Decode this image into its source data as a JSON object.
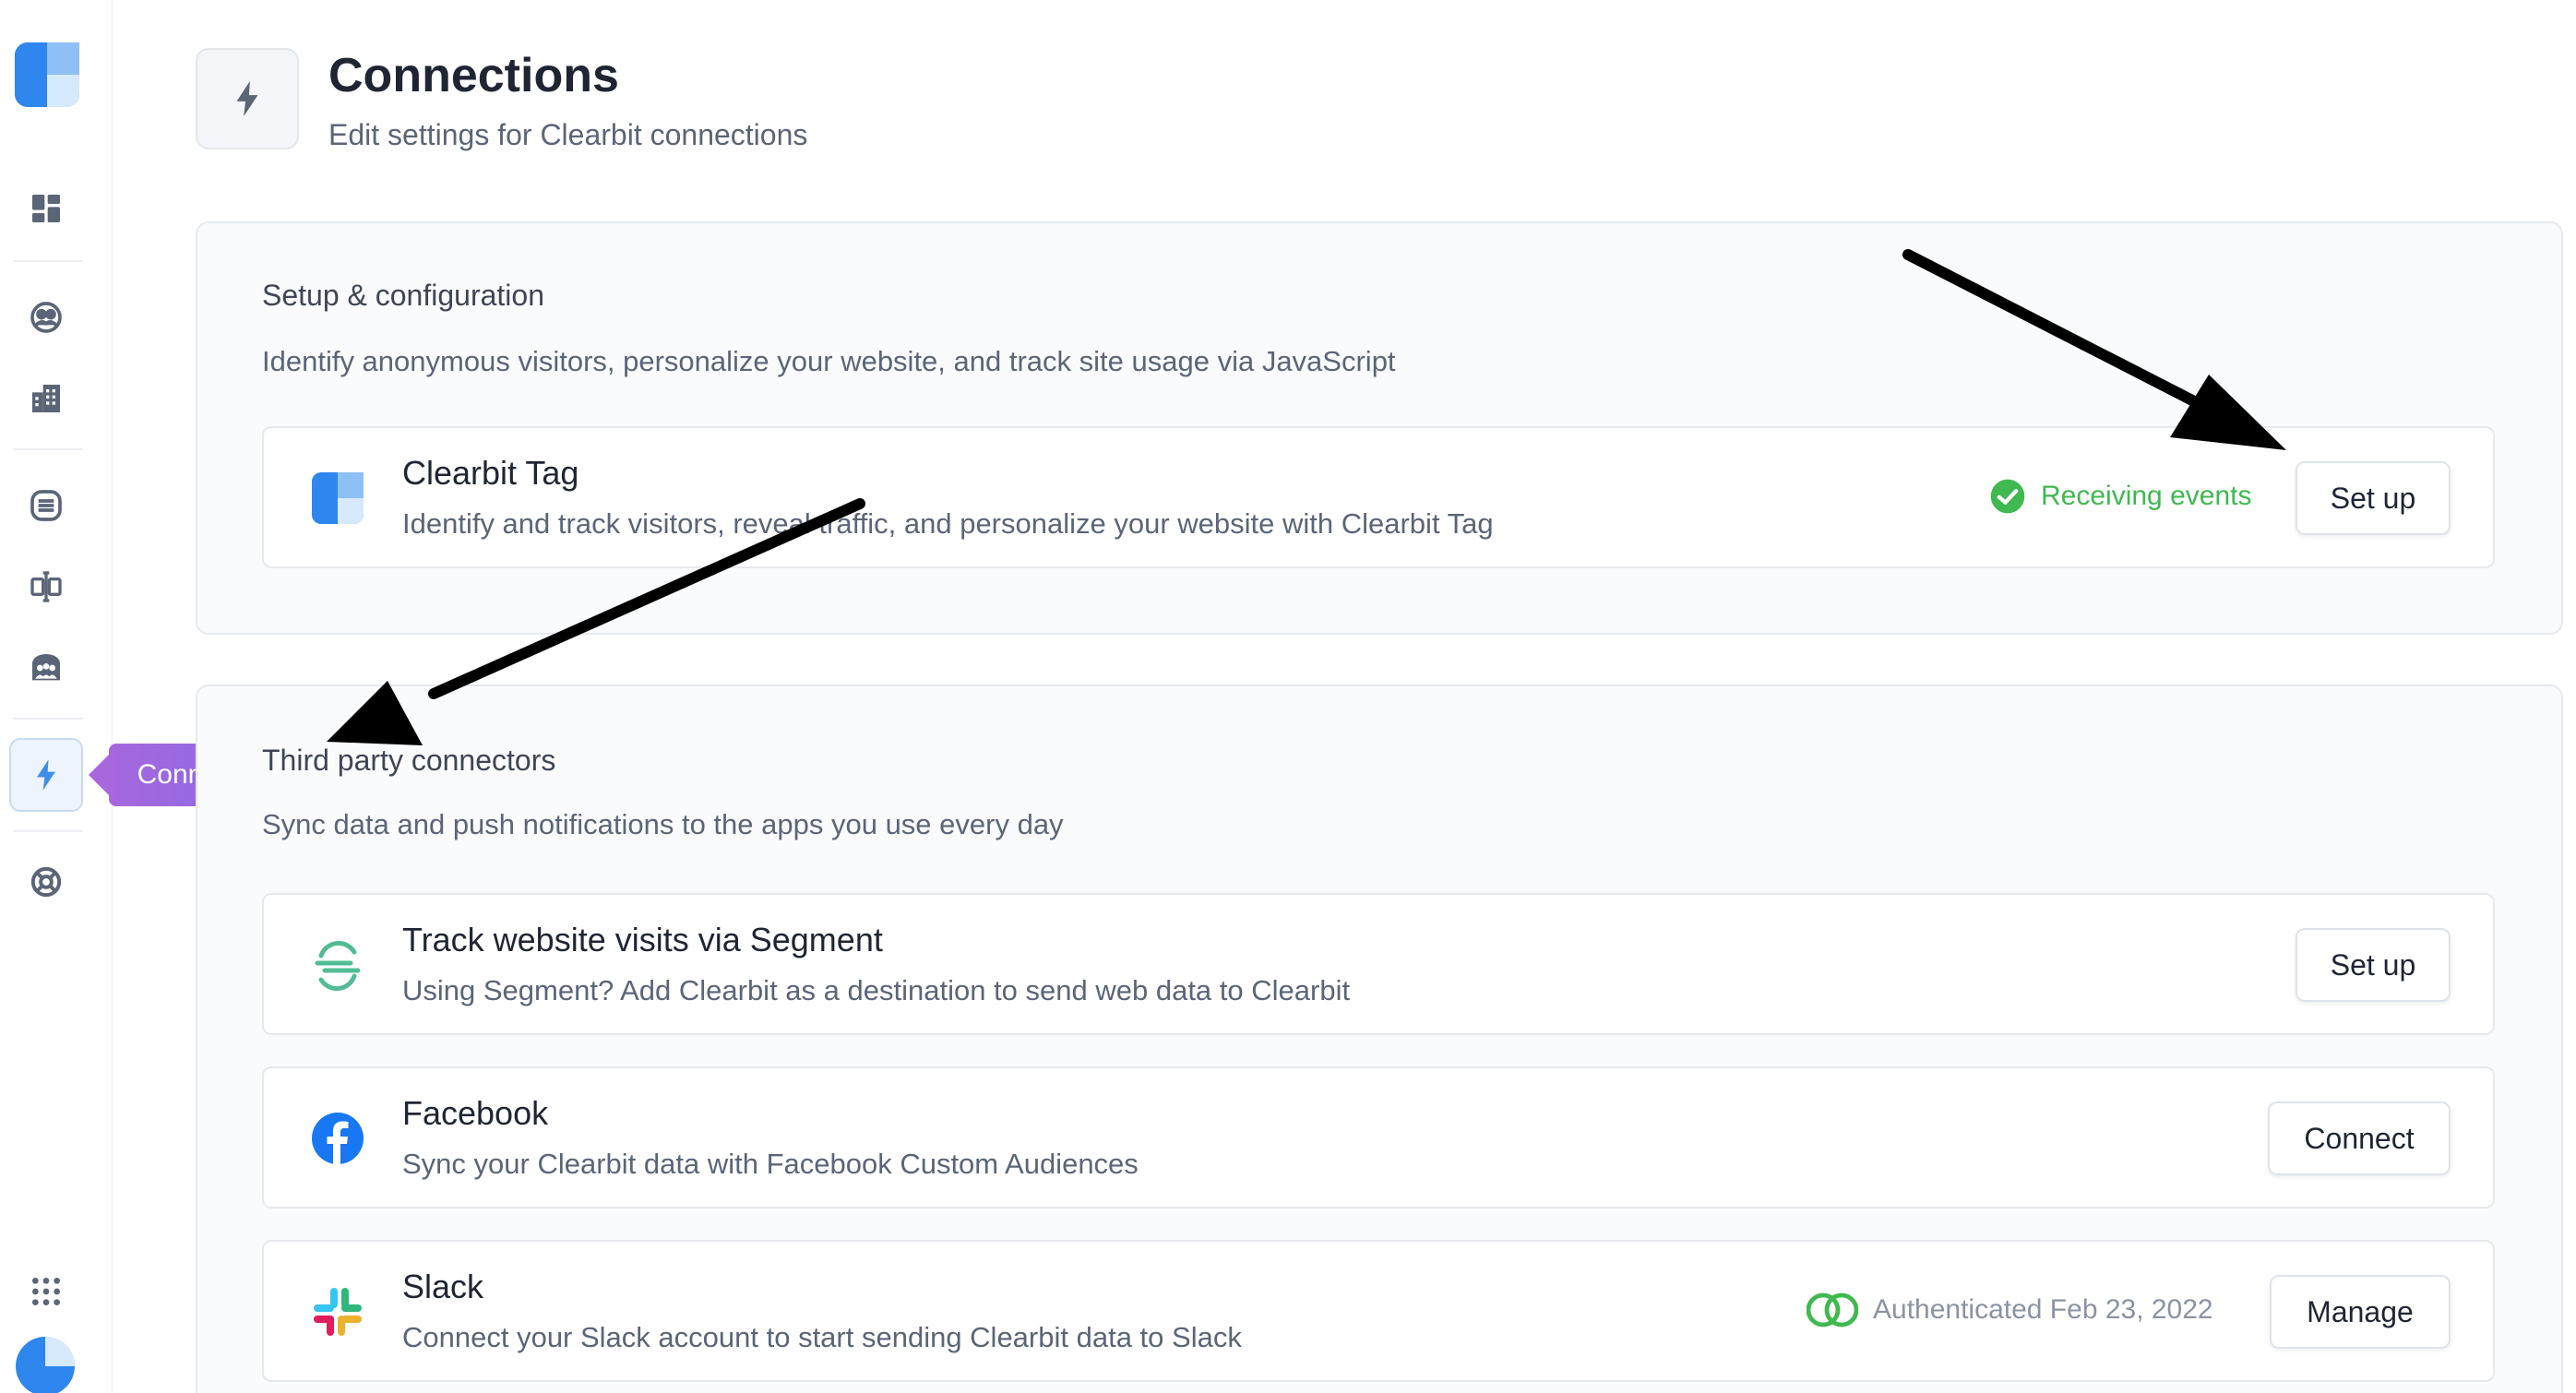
{
  "tooltip": {
    "label": "Connections"
  },
  "header": {
    "title": "Connections",
    "subtitle": "Edit settings for Clearbit connections"
  },
  "setup": {
    "title": "Setup & configuration",
    "description": "Identify anonymous visitors, personalize your website, and track site usage via JavaScript",
    "card": {
      "title": "Clearbit Tag",
      "description": "Identify and track visitors, reveal traffic, and personalize your website with Clearbit Tag",
      "status": "Receiving events",
      "button": "Set up"
    }
  },
  "connectors": {
    "title": "Third party connectors",
    "description": "Sync data and push notifications to the apps you use every day",
    "cards": [
      {
        "title": "Track website visits via Segment",
        "description": "Using Segment? Add Clearbit as a destination to send web data to Clearbit",
        "button": "Set up"
      },
      {
        "title": "Facebook",
        "description": "Sync your Clearbit data with Facebook Custom Audiences",
        "button": "Connect"
      },
      {
        "title": "Slack",
        "description": "Connect your Slack account to start sending Clearbit data to Slack",
        "status": "Authenticated Feb 23, 2022",
        "button": "Manage"
      }
    ]
  },
  "colors": {
    "accent": "#3d8fe8",
    "success": "#3fb950",
    "tooltip": "#9a6ae2",
    "facebook": "#1877f2"
  },
  "icons": {
    "logo": "clearbit-logo",
    "nav": [
      "dashboard-icon",
      "people-icon",
      "companies-icon",
      "database-icon",
      "split-icon",
      "audiences-icon",
      "lightning-icon",
      "support-icon",
      "apps-grid-icon"
    ],
    "avatar": "account-avatar"
  }
}
